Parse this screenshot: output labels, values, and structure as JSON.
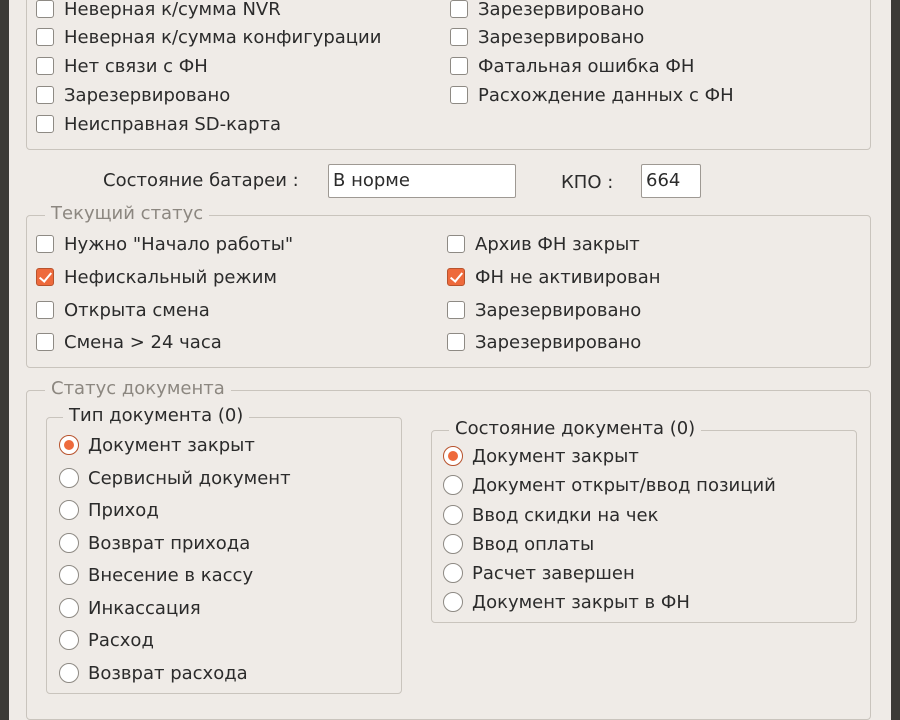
{
  "errors": {
    "left": [
      {
        "label": "Неверная к/сумма NVR",
        "checked": false
      },
      {
        "label": "Неверная к/сумма конфигурации",
        "checked": false
      },
      {
        "label": "Нет связи с ФН",
        "checked": false
      },
      {
        "label": "Зарезервировано",
        "checked": false
      },
      {
        "label": "Неисправная SD-карта",
        "checked": false
      }
    ],
    "right": [
      {
        "label": "Зарезервировано",
        "checked": false
      },
      {
        "label": "Зарезервировано",
        "checked": false
      },
      {
        "label": "Фатальная ошибка ФН",
        "checked": false
      },
      {
        "label": "Расхождение данных с ФН",
        "checked": false
      }
    ]
  },
  "battery": {
    "label": "Состояние батареи :",
    "value": "В норме"
  },
  "kpo": {
    "label": "КПО :",
    "value": "664"
  },
  "current_status": {
    "title": "Текущий статус",
    "left": [
      {
        "label": "Нужно \"Начало работы\"",
        "checked": false
      },
      {
        "label": "Нефискальный режим",
        "checked": true
      },
      {
        "label": "Открыта смена",
        "checked": false
      },
      {
        "label": "Смена > 24 часа",
        "checked": false
      }
    ],
    "right": [
      {
        "label": "Архив ФН закрыт",
        "checked": false
      },
      {
        "label": "ФН не активирован",
        "checked": true
      },
      {
        "label": "Зарезервировано",
        "checked": false
      },
      {
        "label": "Зарезервировано",
        "checked": false
      }
    ]
  },
  "document_status": {
    "title": "Статус документа",
    "doc_type": {
      "title": "Тип документа (0)",
      "options": [
        {
          "label": "Документ закрыт",
          "selected": true
        },
        {
          "label": "Сервисный документ",
          "selected": false
        },
        {
          "label": "Приход",
          "selected": false
        },
        {
          "label": "Возврат прихода",
          "selected": false
        },
        {
          "label": "Внесение в кассу",
          "selected": false
        },
        {
          "label": "Инкассация",
          "selected": false
        },
        {
          "label": "Расход",
          "selected": false
        },
        {
          "label": "Возврат расхода",
          "selected": false
        }
      ]
    },
    "doc_state": {
      "title": "Состояние документа (0)",
      "options": [
        {
          "label": "Документ закрыт",
          "selected": true
        },
        {
          "label": "Документ открыт/ввод позиций",
          "selected": false
        },
        {
          "label": "Ввод скидки на чек",
          "selected": false
        },
        {
          "label": "Ввод оплаты",
          "selected": false
        },
        {
          "label": "Расчет завершен",
          "selected": false
        },
        {
          "label": "Документ закрыт в ФН",
          "selected": false
        }
      ]
    }
  }
}
